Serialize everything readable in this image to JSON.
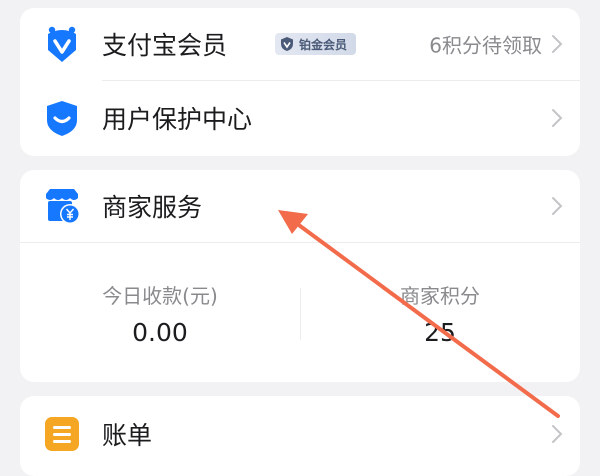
{
  "card1": {
    "membership": {
      "label": "支付宝会员",
      "badge": "铂金会员",
      "right_text": "6积分待领取",
      "icon": "alipay-member-icon"
    },
    "user_protection": {
      "label": "用户保护中心",
      "icon": "shield-icon"
    }
  },
  "merchant": {
    "label": "商家服务",
    "icon": "merchant-store-icon",
    "stats": [
      {
        "title": "今日收款(元)",
        "value": "0.00"
      },
      {
        "title": "商家积分",
        "value": "25"
      }
    ]
  },
  "bills": {
    "label": "账单",
    "icon": "bill-icon"
  },
  "colors": {
    "accent_blue": "#1677ff",
    "bill_orange": "#f5a623",
    "annotation_arrow": "#f26b4b"
  }
}
